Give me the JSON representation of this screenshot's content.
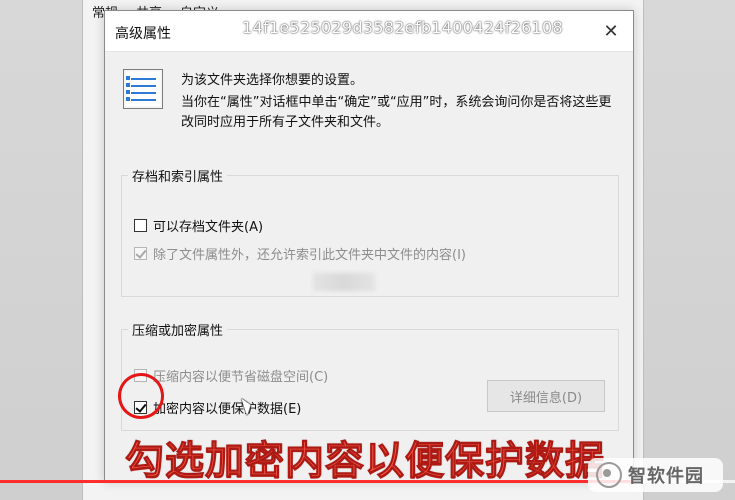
{
  "background_window": {
    "tabs": [
      "常规",
      "共享",
      "自定义"
    ]
  },
  "dialog": {
    "title": "高级属性",
    "overlay_hash": "14f1e525029d3582efb1400424f26108",
    "close_icon": "close-icon",
    "intro": {
      "icon": "properties-list-icon",
      "title": "为该文件夹选择你想要的设置。",
      "description": "当你在“属性”对话框中单击“确定”或“应用”时，系统会询问你是否将这些更改同时应用于所有子文件夹和文件。"
    },
    "archive_group": {
      "label": "存档和索引属性",
      "archive_checkbox": {
        "label": "可以存档文件夹(A)",
        "checked": false,
        "enabled": true
      },
      "index_checkbox": {
        "label": "除了文件属性外，还允许索引此文件夹中文件的内容(I)",
        "checked": true,
        "enabled": false
      }
    },
    "compress_group": {
      "label": "压缩或加密属性",
      "compress_checkbox": {
        "label": "压缩内容以便节省磁盘空间(C)",
        "checked": false,
        "enabled": false
      },
      "encrypt_checkbox": {
        "label": "加密内容以便保护数据(E)",
        "checked": true,
        "enabled": true
      },
      "details_button": "详细信息(D)"
    }
  },
  "overlay": {
    "caption": "勾选加密内容以便保护数据",
    "watermark": "智软件园",
    "progress_percent": 86,
    "colors": {
      "caption": "#ff5c4d",
      "highlight": "#e51616",
      "progress": "#ff2d2d"
    }
  }
}
